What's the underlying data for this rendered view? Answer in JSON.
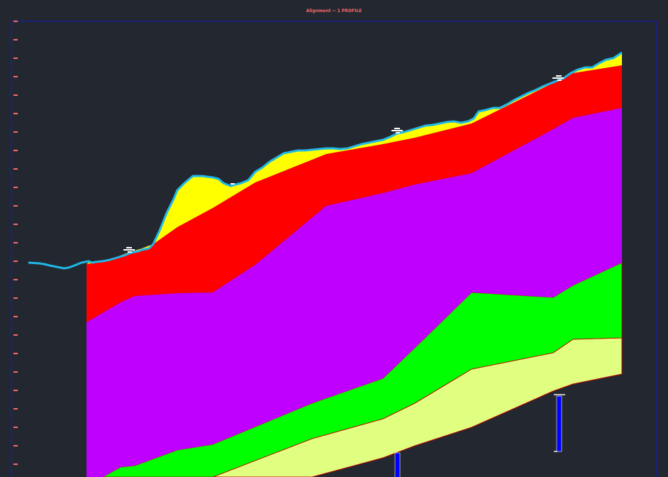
{
  "title": "Alignment  --  1  PROFILE",
  "colors": {
    "background": "#232830",
    "frame": "#1a1aa8",
    "ground_line": "#1fb8e8",
    "topsoil_layer": "#ffff00",
    "layer_red": "#ff0000",
    "layer_purple": "#c000ff",
    "layer_green": "#00ff00",
    "layer_pale": "#e0ff80",
    "boundary_line": "#c00000",
    "borehole": "#0000ff",
    "axis_tick_label": "#ff6a6a"
  },
  "boreholes": [
    {
      "id": "borehole-1"
    },
    {
      "id": "borehole-2"
    },
    {
      "id": "borehole-3"
    }
  ]
}
